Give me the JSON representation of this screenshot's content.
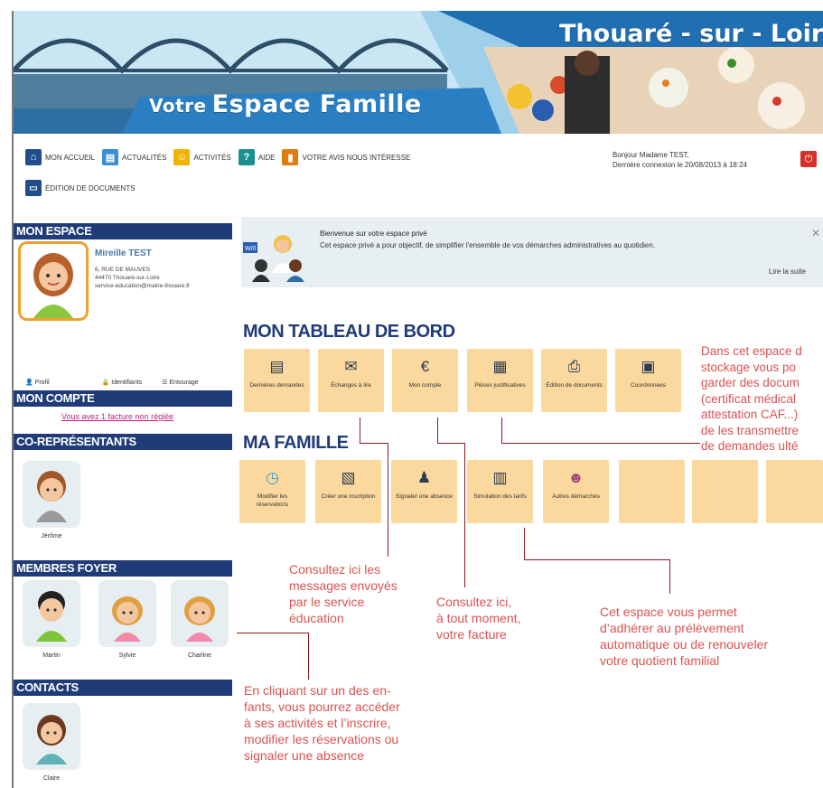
{
  "banner": {
    "title_small": "Votre",
    "title_main": "Espace Famille",
    "town": "Thouaré - sur - Loire"
  },
  "nav": {
    "items": [
      {
        "label": "MON ACCUEIL",
        "icon": "home-icon",
        "color": "#1f4e8a"
      },
      {
        "label": "ACTUALITÉS",
        "icon": "news-icon",
        "color": "#3a8fd0"
      },
      {
        "label": "ACTIVITÉS",
        "icon": "activities-icon",
        "color": "#f0b400"
      },
      {
        "label": "AIDE",
        "icon": "help-icon",
        "color": "#1a8f8f"
      },
      {
        "label": "VOTRE AVIS NOUS INTÉRESSE",
        "icon": "feedback-icon",
        "color": "#e07b10"
      }
    ],
    "doc_label": "ÉDITION DE DOCUMENTS",
    "greeting": "Bonjour Madame TEST,",
    "last_login": "Dernière connexion le 20/08/2013 à 18:24"
  },
  "sidebar": {
    "mon_espace": "MON ESPACE",
    "name": "Mireille TEST",
    "address1": "6, RUE DE MAUVES",
    "address2": "44470 Thouaré-sur-Loire",
    "email": "service-education@mairie-thouare.fr",
    "tabs": [
      "Profil",
      "Identifiants",
      "Entourage"
    ],
    "mon_compte": "MON COMPTE",
    "facture_text": "Vous avez 1 facture non réglée",
    "co_representants": "CO-REPRÉSENTANTS",
    "co_person": "Jérôme",
    "membres_foyer": "MEMBRES FOYER",
    "members": [
      "Martin",
      "Sylvie",
      "Charline"
    ],
    "contacts": "CONTACTS",
    "contact": "Claire"
  },
  "welcome": {
    "title": "Bienvenue sur votre espace privé",
    "text": "Cet espace privé a pour objectif, de simplifier l'ensemble de vos démarches administratives au quotidien.",
    "more": "Lire la suite",
    "badge": "W/0"
  },
  "tableau": {
    "title": "MON TABLEAU DE BORD",
    "tiles": [
      {
        "label": "Dernières demandes",
        "icon": "document-icon"
      },
      {
        "label": "Échanges à lire",
        "icon": "envelope-icon"
      },
      {
        "label": "Mon compte",
        "icon": "euro-icon"
      },
      {
        "label": "Pièces justificatives",
        "icon": "cabinet-icon"
      },
      {
        "label": "Édition de documents",
        "icon": "printer-icon"
      },
      {
        "label": "Coordonnées",
        "icon": "contact-card-icon"
      }
    ]
  },
  "famille": {
    "title": "MA FAMILLE",
    "tiles": [
      {
        "label": "Modifier les réservations",
        "icon": "clock-icon"
      },
      {
        "label": "Créer une inscription",
        "icon": "form-icon"
      },
      {
        "label": "Signaler une absence",
        "icon": "person-icon"
      },
      {
        "label": "Simulation des tarifs",
        "icon": "calculator-icon"
      },
      {
        "label": "Autres démarches",
        "icon": "group-icon"
      }
    ]
  },
  "notes": {
    "stockage": [
      "Dans cet espace d",
      "stockage vous po",
      "garder des docum",
      "(certificat médical",
      "attestation CAF...)",
      "de les transmettre",
      "de demandes ulté"
    ],
    "messages": [
      "Consultez ici les",
      "messages envoyés",
      "par le service",
      "éducation"
    ],
    "facture": [
      "Consultez ici,",
      "à tout moment,",
      "votre facture"
    ],
    "prelevement": [
      "Cet espace vous permet",
      "d’adhérer au prélèvement",
      "automatique ou de renouveler",
      "votre quotient familial"
    ],
    "enfants": [
      "En cliquant sur un des en-",
      "fants, vous pourrez accéder",
      "à ses activités et l’inscrire,",
      "modifier les réservations ou",
      "signaler une absence"
    ]
  },
  "colors": {
    "accent": "#1f3b78",
    "tile": "#fbd89e",
    "note": "#d9534f"
  }
}
